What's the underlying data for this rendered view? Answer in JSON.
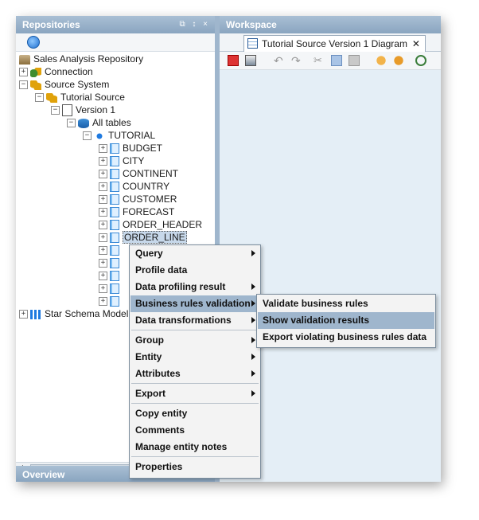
{
  "repositories": {
    "title": "Repositories",
    "header_controls": "⧉ ↕ ×",
    "tree": [
      {
        "label": "Sales Analysis Repository",
        "icon": "repository-icon"
      },
      {
        "label": "Connection",
        "icon": "connection-icon"
      },
      {
        "label": "Source System",
        "icon": "source-system-icon"
      },
      {
        "label": "Tutorial Source",
        "icon": "source-system-icon"
      },
      {
        "label": "Version 1",
        "icon": "version-icon"
      },
      {
        "label": "All tables",
        "icon": "database-icon"
      },
      {
        "label": "TUTORIAL",
        "icon": "schema-icon"
      },
      {
        "label": "BUDGET",
        "icon": "table-icon"
      },
      {
        "label": "CITY",
        "icon": "table-icon"
      },
      {
        "label": "CONTINENT",
        "icon": "table-icon"
      },
      {
        "label": "COUNTRY",
        "icon": "table-icon"
      },
      {
        "label": "CUSTOMER",
        "icon": "table-icon"
      },
      {
        "label": "FORECAST",
        "icon": "table-icon"
      },
      {
        "label": "ORDER_HEADER",
        "icon": "table-icon"
      },
      {
        "label": "ORDER_LINE",
        "icon": "table-icon",
        "selected": true
      },
      {
        "label": "Star Schema Model",
        "icon": "star-schema-icon"
      }
    ]
  },
  "overview": {
    "title": "Overview"
  },
  "workspace": {
    "title": "Workspace",
    "tab_label": "Tutorial Source Version 1 Diagram",
    "tab_close": "✕"
  },
  "context_menu": {
    "items": [
      {
        "label": "Query",
        "submenu": true
      },
      {
        "label": "Profile data",
        "submenu": false
      },
      {
        "label": "Data profiling result",
        "submenu": true
      },
      {
        "label": "Business rules validation",
        "submenu": true,
        "highlighted": true
      },
      {
        "label": "Data transformations",
        "submenu": true
      },
      {
        "label": "Group",
        "submenu": true
      },
      {
        "label": "Entity",
        "submenu": true
      },
      {
        "label": "Attributes",
        "submenu": true
      },
      {
        "label": "Export",
        "submenu": true
      },
      {
        "label": "Copy entity",
        "submenu": false
      },
      {
        "label": "Comments",
        "submenu": false
      },
      {
        "label": "Manage entity notes",
        "submenu": false
      },
      {
        "label": "Properties",
        "submenu": false
      }
    ]
  },
  "submenu": {
    "items": [
      {
        "label": "Validate business rules"
      },
      {
        "label": "Show validation results",
        "highlighted": true
      },
      {
        "label": "Export violating business rules data"
      }
    ]
  },
  "colors": {
    "panel_header": "#8aa5c0",
    "highlight": "#9fb6cd",
    "workspace_bg": "#e4eef6"
  }
}
